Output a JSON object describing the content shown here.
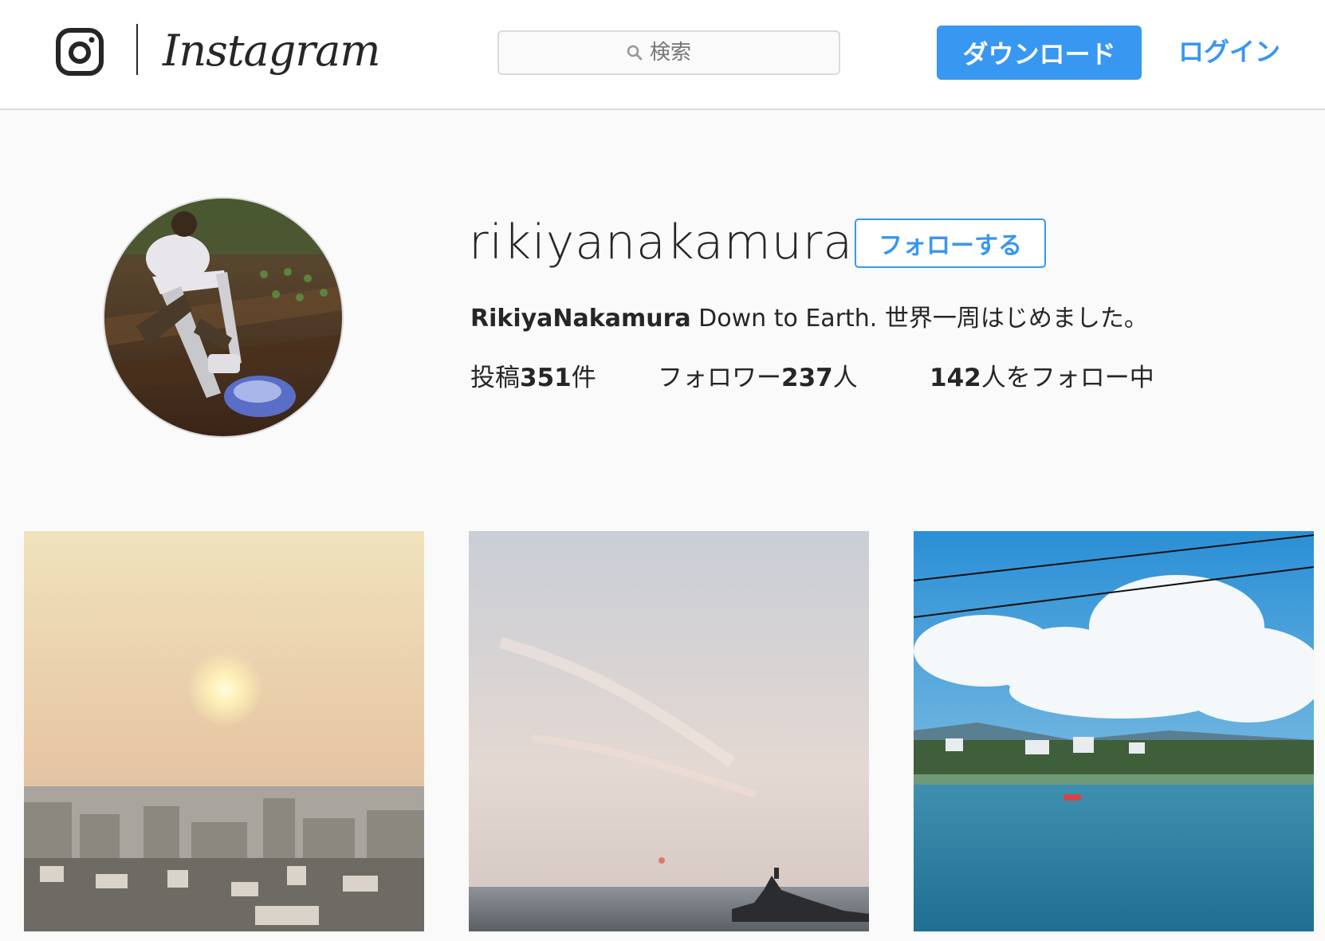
{
  "header": {
    "brand": "Instagram",
    "logo_icon": "instagram-camera-icon",
    "search": {
      "placeholder": "検索",
      "icon": "search-icon"
    },
    "download_label": "ダウンロード",
    "login_label": "ログイン"
  },
  "profile": {
    "username": "rikiyanakamura",
    "follow_label": "フォローする",
    "bio_name": "RikiyaNakamura",
    "bio_text": " Down to Earth. 世界一周はじめました。",
    "stats": {
      "posts_prefix": "投稿",
      "posts_count": "351",
      "posts_suffix": "件",
      "followers_prefix": "フォロワー",
      "followers_count": "237",
      "followers_suffix": "人",
      "following_count": "142",
      "following_suffix": "人をフォロー中"
    }
  },
  "colors": {
    "accent": "#3897f0",
    "text": "#262626",
    "border": "#dbdbdb",
    "background": "#fafafa"
  }
}
